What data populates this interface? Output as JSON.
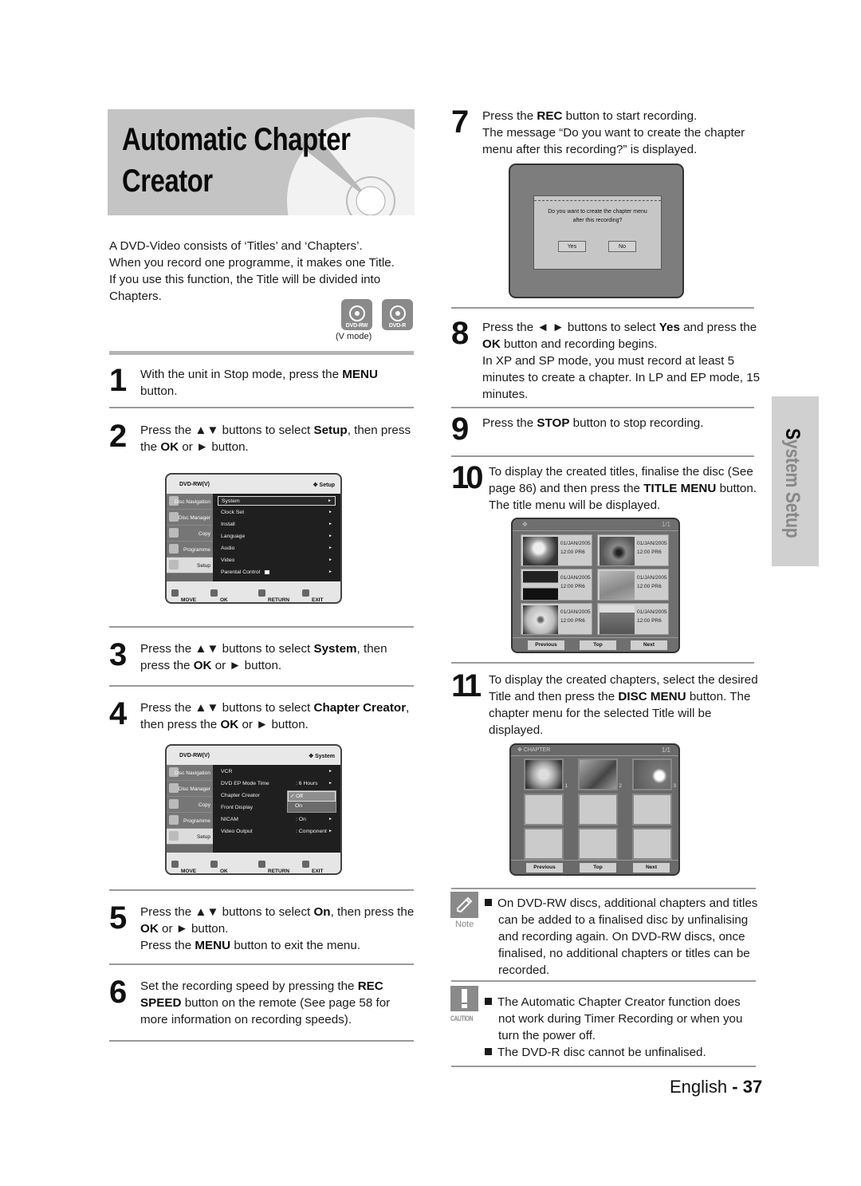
{
  "title": {
    "line1": "Automatic Chapter",
    "line2": "Creator"
  },
  "intro": {
    "lines": [
      "A DVD-Video consists of ‘Titles’ and ‘Chapters’.",
      "When you record one programme, it makes one Title.",
      "If you use this function, the Title will be divided into",
      "Chapters."
    ],
    "badges": [
      "DVD-RW",
      "DVD-R"
    ],
    "badge_note": "(V mode)"
  },
  "steps": [
    {
      "num": "1",
      "parts": [
        "With the unit in Stop mode, press the ",
        "MENU",
        " button."
      ]
    },
    {
      "num": "2",
      "parts": [
        "Press the ▲▼ buttons to select ",
        "Setup",
        ", then press the ",
        "OK",
        " or ► button."
      ]
    },
    {
      "num": "3",
      "parts": [
        "Press the ▲▼ buttons to select ",
        "System",
        ", then press the ",
        "OK",
        " or ► button."
      ]
    },
    {
      "num": "4",
      "parts": [
        "Press the ▲▼ buttons to select ",
        "Chapter Creator",
        ", then press the ",
        "OK",
        " or ► button."
      ]
    },
    {
      "num": "5",
      "parts": [
        "Press the ▲▼ buttons to select ",
        "On",
        ", then press the ",
        "OK",
        " or ► button.",
        "Press the ",
        "MENU",
        " button to exit the menu."
      ]
    },
    {
      "num": "6",
      "parts": [
        "Set the recording speed by pressing the ",
        "REC SPEED",
        " button on the remote (See page 58 for more information on recording speeds)."
      ]
    },
    {
      "num": "7",
      "parts": [
        "Press the ",
        "REC",
        " button to start recording.",
        "The message “Do you want to create the chapter menu after this recording?” is displayed."
      ]
    },
    {
      "num": "8",
      "parts": [
        "Press the ◄ ► buttons to select ",
        "Yes",
        " and press the ",
        "OK",
        " button and recording begins.",
        "In XP and SP mode, you must record at least 5 minutes to create a chapter. In LP and EP mode, 15 minutes."
      ]
    },
    {
      "num": "9",
      "parts": [
        "Press the ",
        "STOP",
        " button to stop recording."
      ]
    },
    {
      "num": "10",
      "parts": [
        "To display the created titles, finalise the disc (See page 86) and then press the ",
        "TITLE MENU",
        " button. The title menu will be displayed."
      ]
    },
    {
      "num": "11",
      "parts": [
        "To display the created chapters, select the desired Title and then press the ",
        "DISC MENU",
        " button. The chapter menu for the selected Title will be displayed."
      ]
    }
  ],
  "osd_setup": {
    "disc": "DVD-RW(V)",
    "section": "Setup",
    "sidebar": [
      "Disc Navigation",
      "Disc Manager",
      "Copy",
      "Programme",
      "Setup"
    ],
    "selected_sidebar": "Setup",
    "rows": [
      {
        "label": "System",
        "value": "",
        "highlighted": true
      },
      {
        "label": "Clock Set",
        "value": ""
      },
      {
        "label": "Install",
        "value": ""
      },
      {
        "label": "Language",
        "value": ""
      },
      {
        "label": "Audio",
        "value": ""
      },
      {
        "label": "Video",
        "value": ""
      },
      {
        "label": "Parental Control",
        "value": "",
        "icon": "lock-open-icon"
      }
    ],
    "footer": [
      "MOVE",
      "OK",
      "RETURN",
      "EXIT"
    ]
  },
  "osd_system": {
    "disc": "DVD-RW(V)",
    "section": "System",
    "sidebar": [
      "Disc Navigation",
      "Disc Manager",
      "Copy",
      "Programme",
      "Setup"
    ],
    "selected_sidebar": "Setup",
    "rows": [
      {
        "label": "VCR",
        "value": ""
      },
      {
        "label": "DVD EP Mode Time",
        "value": ": 6 Hours"
      },
      {
        "label": "Chapter Creator",
        "value": ""
      },
      {
        "label": "Front Display",
        "value": ""
      },
      {
        "label": "NICAM",
        "value": ": On"
      },
      {
        "label": "Video Output",
        "value": ": Component"
      }
    ],
    "popup_options": [
      "Off",
      "On"
    ],
    "popup_checked": "Off",
    "footer": [
      "MOVE",
      "OK",
      "RETURN",
      "EXIT"
    ]
  },
  "dialog": {
    "message_line1": "Do you  want to create the chapter menu",
    "message_line2": "after this recording?",
    "yes": "Yes",
    "no": "No"
  },
  "title_menu": {
    "page": "1/1",
    "items": [
      {
        "date": "01/JAN/2005",
        "time": "12:00 PR6"
      },
      {
        "date": "01/JAN/2005",
        "time": "12:00 PR6"
      },
      {
        "date": "01/JAN/2005",
        "time": "12:00 PR6"
      },
      {
        "date": "01/JAN/2005",
        "time": "12:00 PR6"
      },
      {
        "date": "01/JAN/2005",
        "time": "12:00 PR6"
      },
      {
        "date": "01/JAN/2005",
        "time": "12:00 PR6"
      }
    ],
    "buttons": [
      "Previous",
      "Top",
      "Next"
    ]
  },
  "chapter_menu": {
    "label": "CHAPTER",
    "page": "1/1",
    "chapter_numbers": [
      "1",
      "2",
      "3"
    ],
    "buttons": [
      "Previous",
      "Top",
      "Next"
    ]
  },
  "note": {
    "label": "Note",
    "text": "On DVD-RW discs, additional chapters and titles can be added to a finalised disc by unfinalising and recording again. On DVD-RW discs, once finalised, no additional chapters or titles can be recorded."
  },
  "caution": {
    "label": "CAUTION",
    "items": [
      "The Automatic Chapter Creator function does not work during Timer Recording or when you turn the power off.",
      "The DVD-R disc cannot be unfinalised."
    ]
  },
  "side_tab": {
    "first": "S",
    "rest": "ystem Setup"
  },
  "footer": {
    "language": "English",
    "sep": " - ",
    "page": "37"
  }
}
